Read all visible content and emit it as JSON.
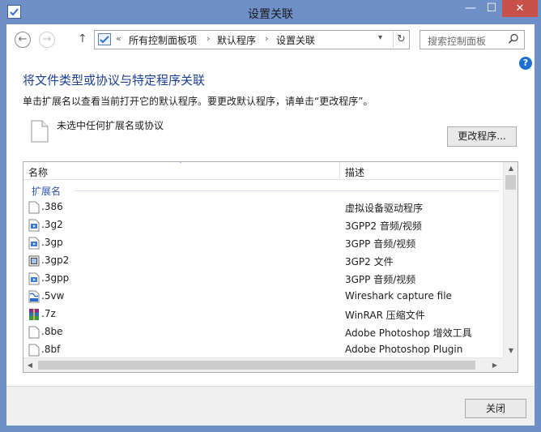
{
  "window": {
    "title": "设置关联",
    "min_glyph": "—",
    "max_glyph": "☐",
    "close_glyph": "✕"
  },
  "nav": {
    "back_glyph": "←",
    "forward_glyph": "→",
    "up_glyph": "↑",
    "chevrons": "«",
    "breadcrumb": [
      "所有控制面板项",
      "默认程序",
      "设置关联"
    ],
    "separator": "›",
    "dropdown_glyph": "▾",
    "refresh_glyph": "↻",
    "search_placeholder": "搜索控制面板"
  },
  "help_glyph": "?",
  "main": {
    "heading": "将文件类型或协议与特定程序关联",
    "instruction": "单击扩展名以查看当前打开它的默认程序。要更改默认程序，请单击“更改程序”。",
    "selection_text": "未选中任何扩展名或协议",
    "change_button": "更改程序..."
  },
  "list": {
    "columns": {
      "name": "名称",
      "description": "描述"
    },
    "sort_glyph": "˄",
    "group": "扩展名",
    "rows": [
      {
        "name": ".386",
        "description": "虚拟设备驱动程序",
        "icon": "blank-file-icon"
      },
      {
        "name": ".3g2",
        "description": "3GPP2 音频/视频",
        "icon": "media-file-icon"
      },
      {
        "name": ".3gp",
        "description": "3GPP 音频/视频",
        "icon": "media-file-icon"
      },
      {
        "name": ".3gp2",
        "description": "3GP2 文件",
        "icon": "film-file-icon"
      },
      {
        "name": ".3gpp",
        "description": "3GPP 音频/视频",
        "icon": "media-file-icon"
      },
      {
        "name": ".5vw",
        "description": "Wireshark capture file",
        "icon": "wireshark-file-icon"
      },
      {
        "name": ".7z",
        "description": "WinRAR 压缩文件",
        "icon": "winrar-archive-icon"
      },
      {
        "name": ".8be",
        "description": "Adobe Photoshop 增效工具",
        "icon": "blank-file-icon"
      },
      {
        "name": ".8bf",
        "description": "Adobe Photoshop Plugin",
        "icon": "blank-file-icon"
      }
    ],
    "scroll_up_glyph": "▲",
    "scroll_down_glyph": "▼",
    "scroll_left_glyph": "◀",
    "scroll_right_glyph": "▶"
  },
  "footer": {
    "close_button": "关闭"
  },
  "colors": {
    "titlebar": "#6f8fc7",
    "close_button": "#c7504b",
    "heading": "#1c3f94",
    "group_header": "#2b56b5",
    "help": "#1c6fd1"
  }
}
